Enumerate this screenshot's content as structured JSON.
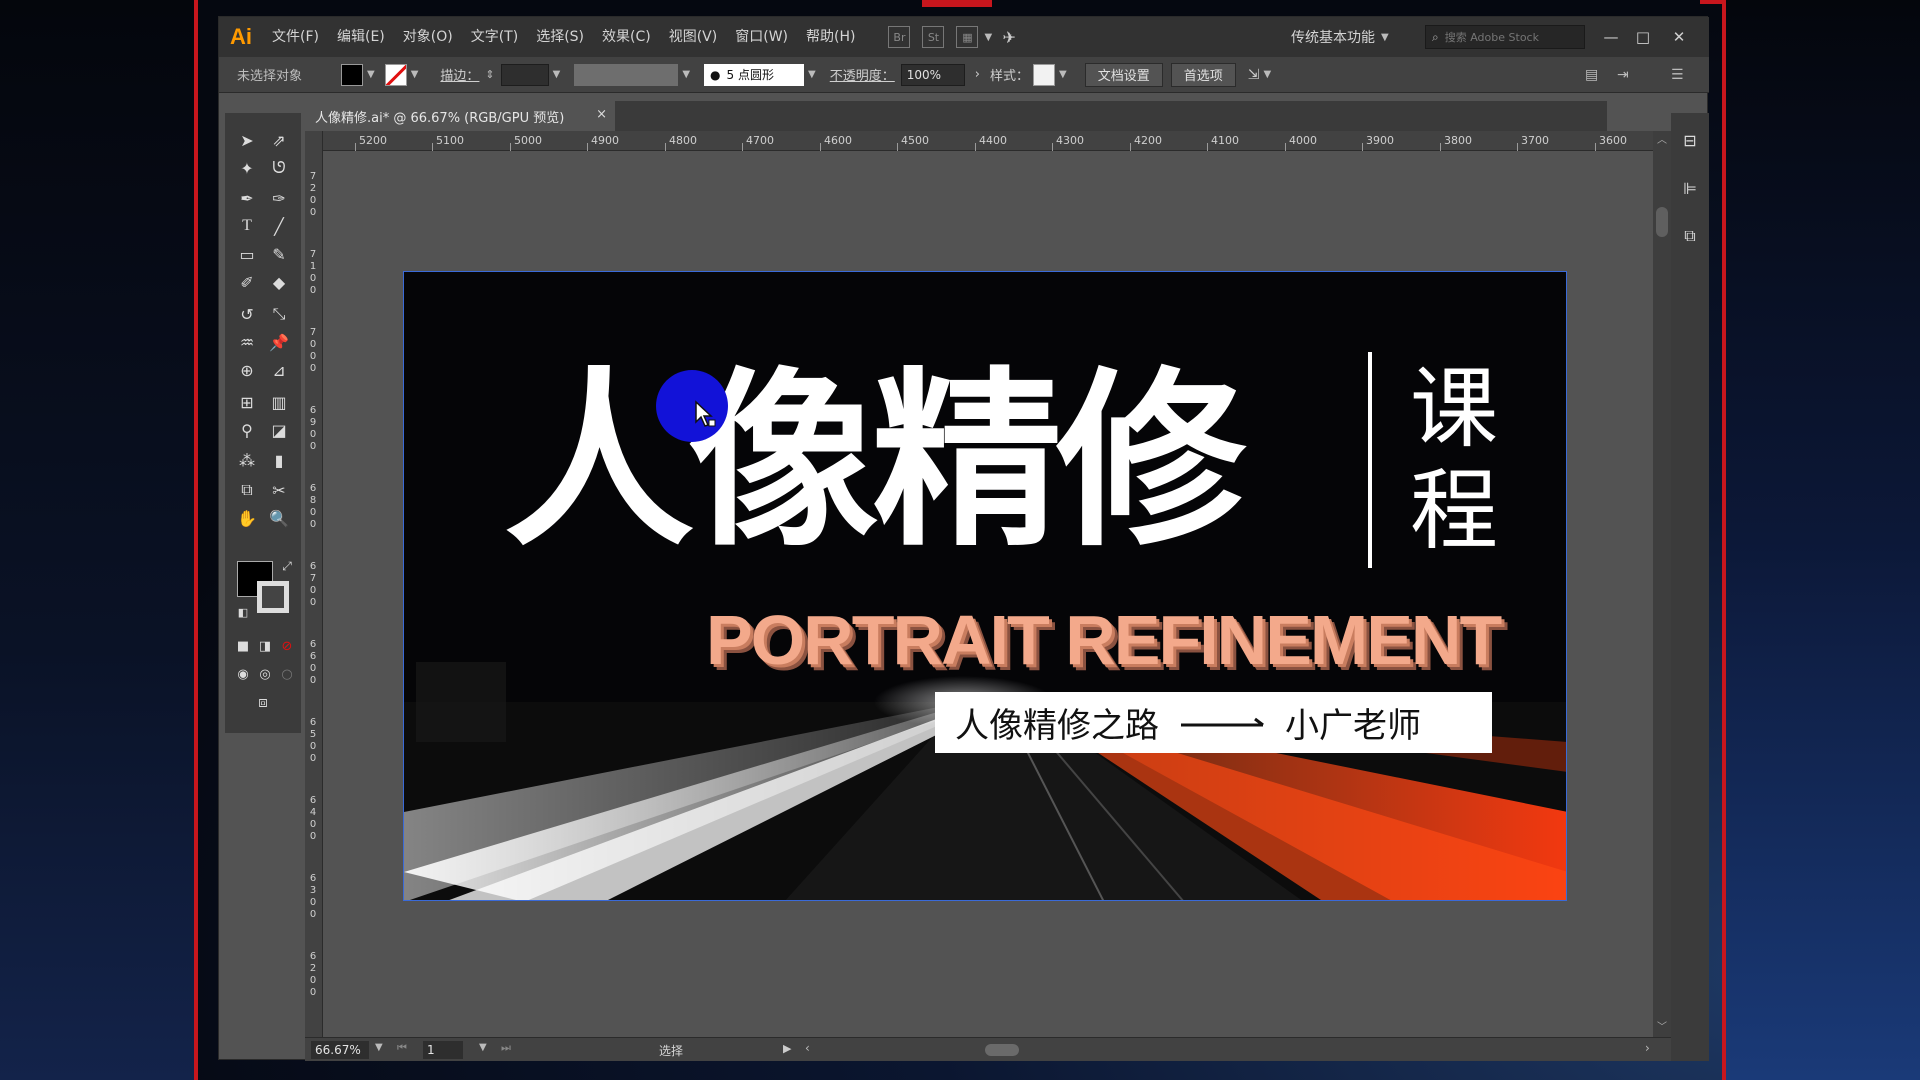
{
  "app": {
    "logo": "Ai",
    "menu": [
      "文件(F)",
      "编辑(E)",
      "对象(O)",
      "文字(T)",
      "选择(S)",
      "效果(C)",
      "视图(V)",
      "窗口(W)",
      "帮助(H)"
    ],
    "bar_icons": [
      "Br",
      "St"
    ],
    "workspace": "传统基本功能",
    "search_placeholder": "搜索 Adobe Stock",
    "window_buttons": [
      "—",
      "□",
      "✕"
    ]
  },
  "controlbar": {
    "selection": "未选择对象",
    "stroke_label": "描边：",
    "brush": "5 点圆形",
    "opacity_label": "不透明度：",
    "opacity_value": "100%",
    "style_label": "样式：",
    "doc_setup": "文档设置",
    "preferences": "首选项"
  },
  "tab": {
    "title": "人像精修.ai* @ 66.67% (RGB/GPU 预览)",
    "close": "×"
  },
  "ruler": {
    "top": [
      "5200",
      "5100",
      "5000",
      "4900",
      "4800",
      "4700",
      "4600",
      "4500",
      "4400",
      "4300",
      "4200",
      "4100",
      "4000",
      "3900",
      "3800",
      "3700",
      "3600"
    ],
    "left": [
      "7200",
      "7100",
      "7000",
      "6900",
      "6800",
      "6700",
      "6600",
      "6500",
      "6400",
      "6300",
      "6200"
    ]
  },
  "artwork": {
    "title_cn": "人像精修",
    "title_side": [
      "课",
      "程"
    ],
    "title_en": "PORTRAIT REFINEMENT",
    "subtitle_left": "人像精修之路",
    "subtitle_right": "小广老师"
  },
  "statusbar": {
    "zoom": "66.67%",
    "page": "1",
    "tool": "选择"
  },
  "colors": {
    "accent": "#ff9a00",
    "artboard_border": "#3a6ad8",
    "eng_text": "#f3a98b",
    "cursor_dot": "#1212d8",
    "red_edge": "#c8161d"
  }
}
